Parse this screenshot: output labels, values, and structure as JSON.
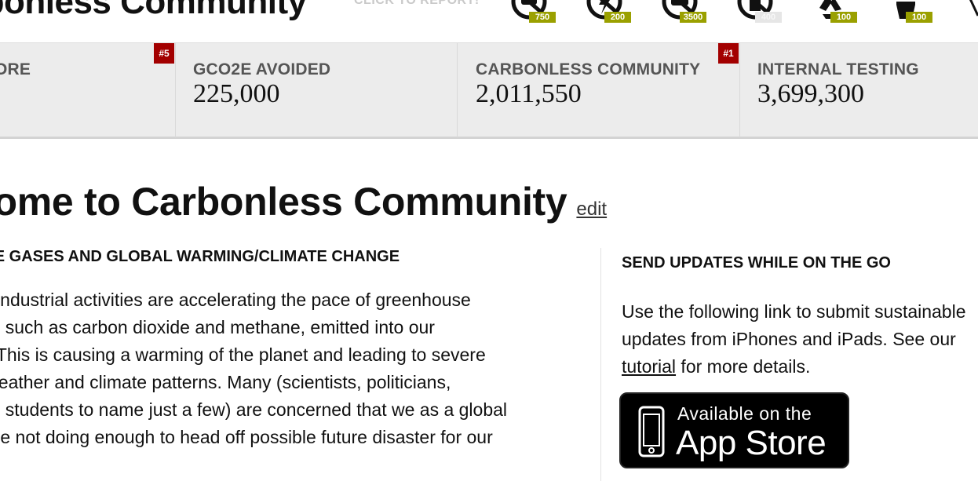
{
  "header": {
    "site_title": "rbonless Community",
    "click_to_report": "CLICK TO REPORT!",
    "actions": [
      {
        "icon": "no-car-icon",
        "count": "750",
        "state": "active"
      },
      {
        "icon": "no-electricity-icon",
        "count": "200",
        "state": "active"
      },
      {
        "icon": "no-driving-icon",
        "count": "3500",
        "state": "active"
      },
      {
        "icon": "no-trash-icon",
        "count": "400",
        "state": "disabled"
      },
      {
        "icon": "recycle-icon",
        "count": "100",
        "state": "active"
      },
      {
        "icon": "reusable-cup-icon",
        "count": "100",
        "state": "active"
      }
    ],
    "colors": {
      "count_badge": "#9aa000",
      "rank_badge": "#a30000"
    }
  },
  "stats": [
    {
      "label": "ORE",
      "value": "",
      "rank": "#5"
    },
    {
      "label": "GCO2E AVOIDED",
      "value": "225,000",
      "rank": ""
    },
    {
      "label": "CARBONLESS COMMUNITY",
      "value": "2,011,550",
      "rank": "#1"
    },
    {
      "label": "INTERNAL TESTING",
      "value": "3,699,300",
      "rank": ""
    }
  ],
  "main": {
    "title": "come to Carbonless Community",
    "edit_label": "edit",
    "section_heading": "USE GASES AND GLOBAL WARMING/CLIMATE CHANGE",
    "paragraph_lines": [
      "d's industrial activities are accelerating the pace of greenhouse",
      "IG), such as carbon dioxide and methane, emitted into our",
      "re. This is causing a warming of the planet and leading to severe",
      "n weather and climate patterns. Many (scientists, politicians,",
      " and students to name just a few) are concerned that we as a global",
      "y are not doing enough to head off possible future disaster for our"
    ]
  },
  "sidebar": {
    "heading": "SEND UPDATES WHILE ON THE GO",
    "line1": "Use the following link to submit sustainable",
    "line2": "updates from iPhones and iPads. See our",
    "tutorial_link": "tutorial",
    "line3_rest": " for more details.",
    "appstore": {
      "small": "Available on the",
      "big": "App Store"
    }
  }
}
